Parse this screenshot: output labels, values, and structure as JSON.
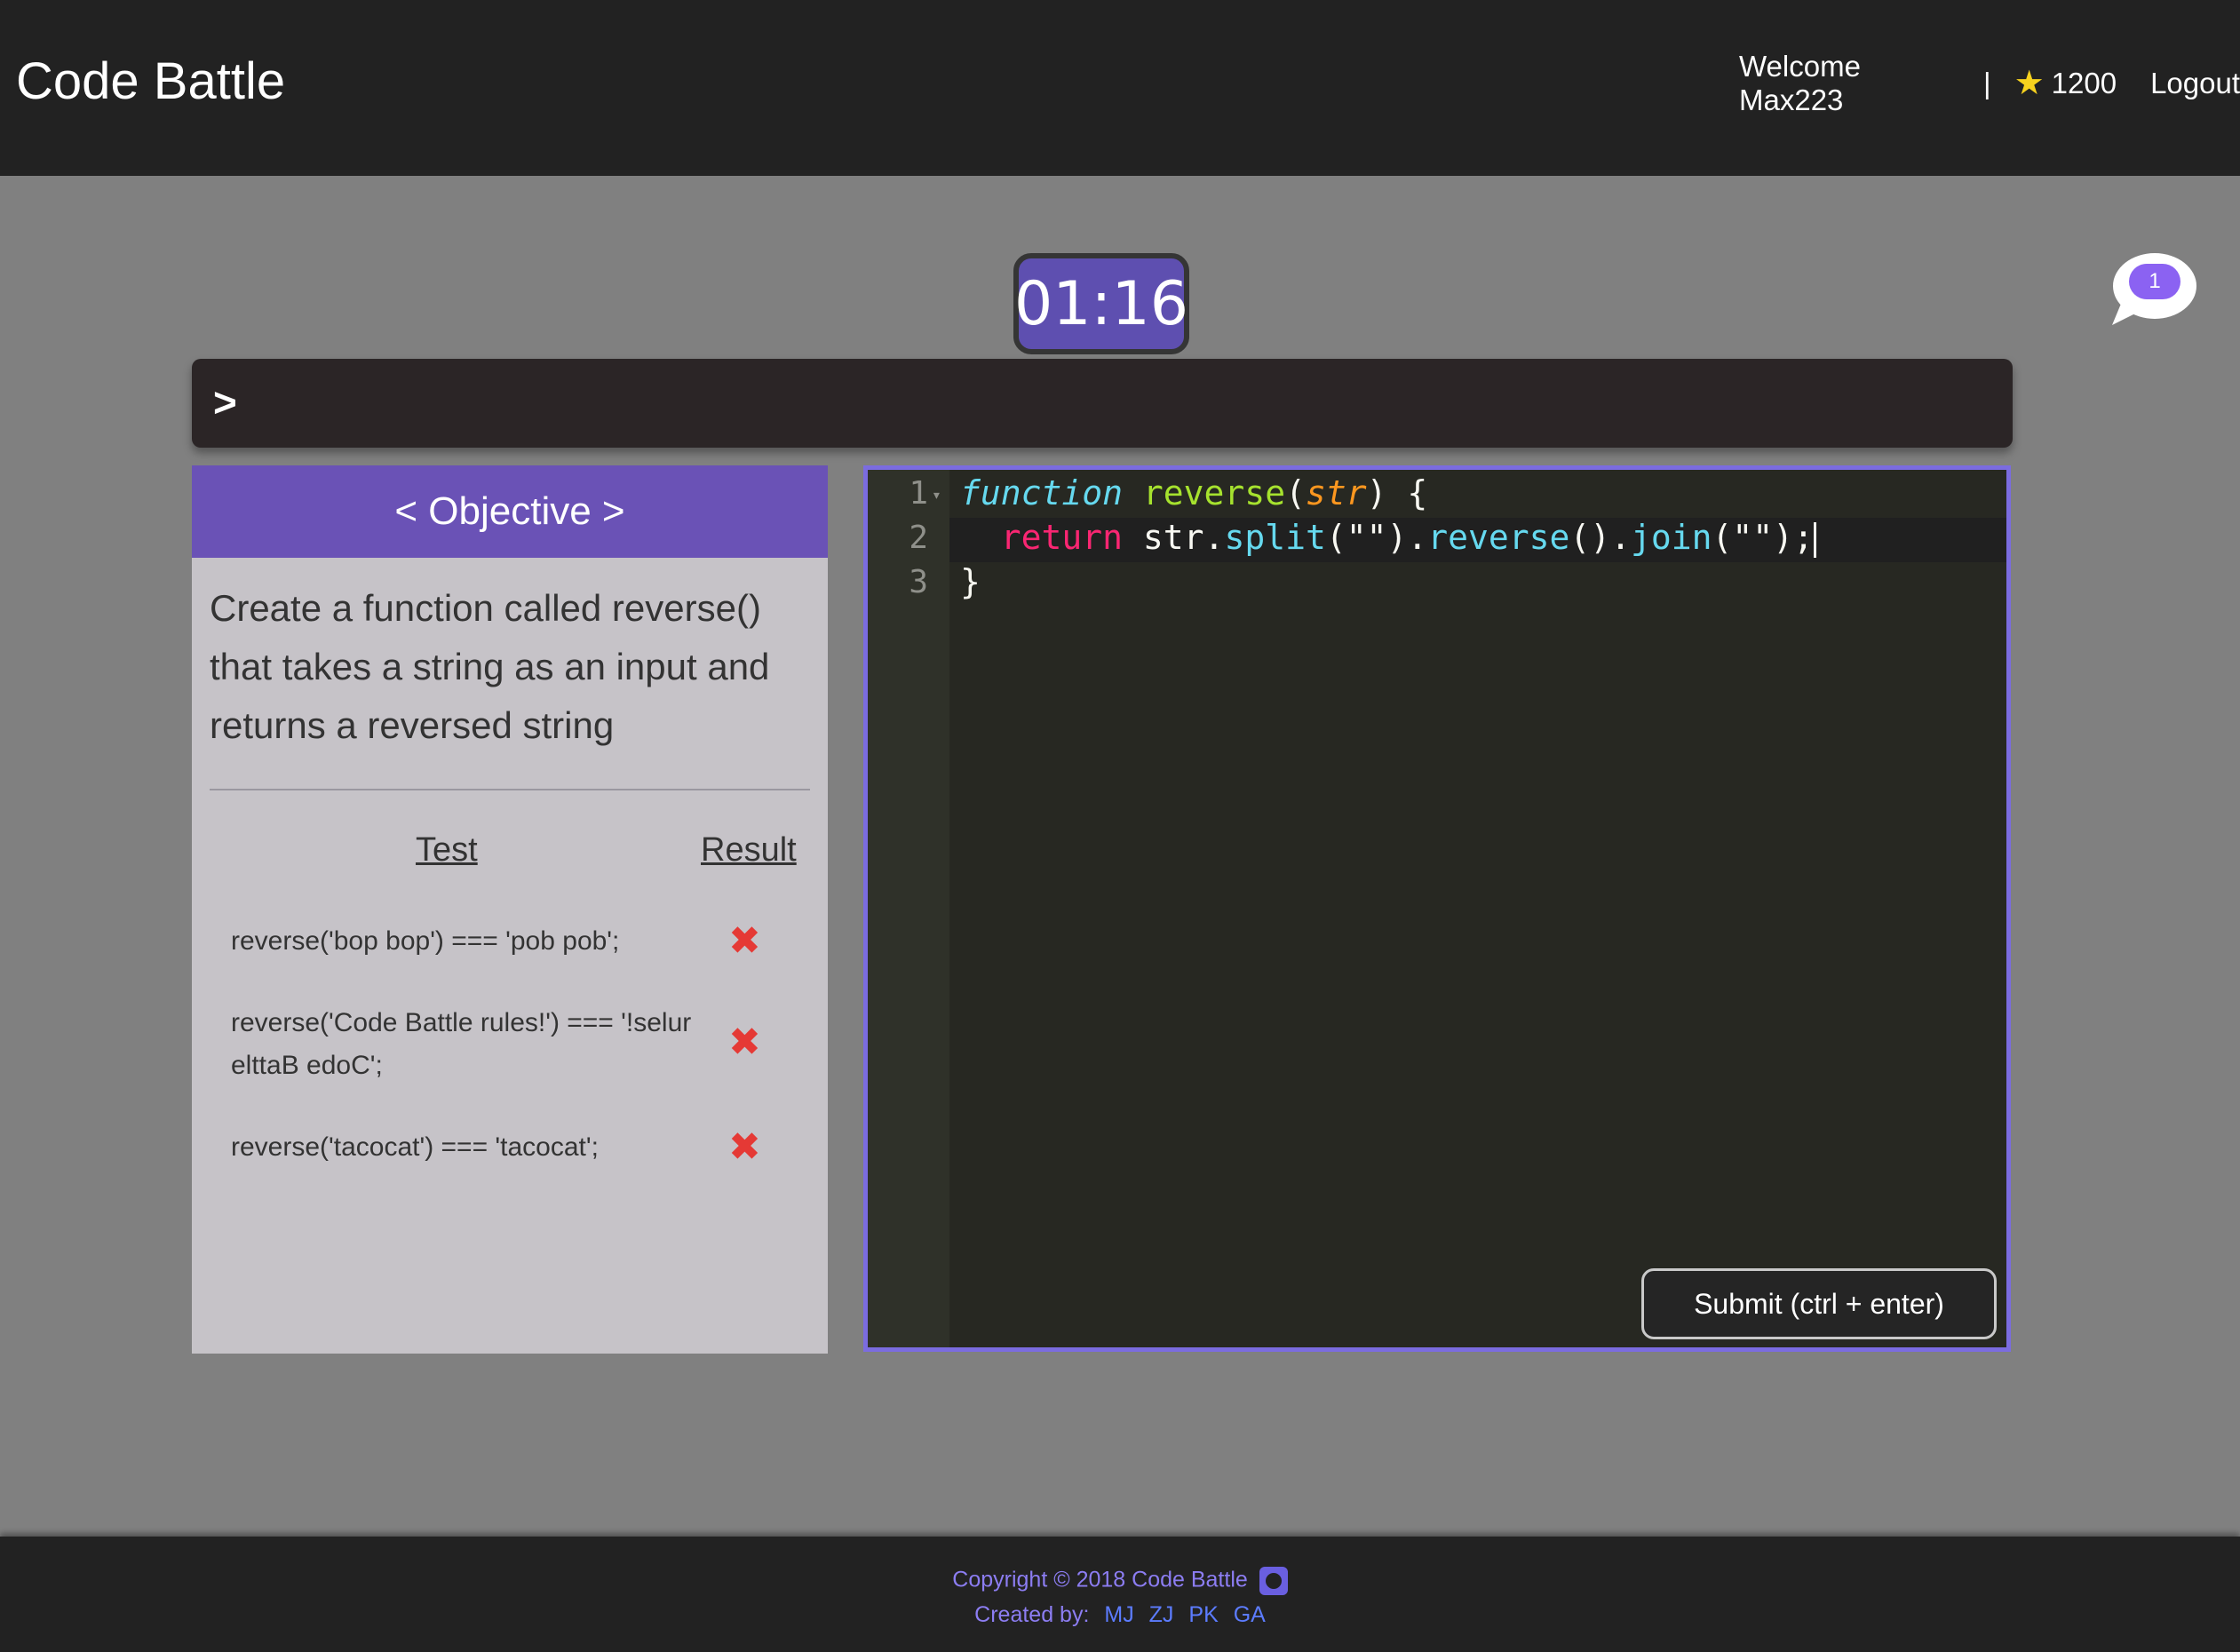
{
  "navbar": {
    "brand": "Code Battle",
    "welcome": "Welcome Max223",
    "separator": "|",
    "points": "1200",
    "logout": "Logout"
  },
  "chat": {
    "unread_count": "1"
  },
  "timer": {
    "value": "01:16"
  },
  "console": {
    "prompt": ">"
  },
  "objective": {
    "header": "< Objective >",
    "description": "Create a function called reverse() that takes a string as an input and returns a reversed string",
    "columns": {
      "test": "Test",
      "result": "Result"
    },
    "tests": [
      {
        "code": "reverse('bop bop') === 'pob pob';",
        "result": "✖"
      },
      {
        "code": "reverse('Code Battle rules!') === '!selur elttaB edoC';",
        "result": "✖"
      },
      {
        "code": "reverse('tacocat') === 'tacocat';",
        "result": "✖"
      }
    ]
  },
  "editor": {
    "line_numbers": [
      "1",
      "2",
      "3"
    ],
    "lines": {
      "l1": {
        "kw": "function",
        "name": "reverse",
        "open": "(",
        "param": "str",
        "close": ") {"
      },
      "l2": {
        "ret": "return",
        "obj": " str.",
        "split": "split",
        "split_args": "(\"\").",
        "rev": "reverse",
        "rev_args": "().",
        "join": "join",
        "join_args": "(\"\");"
      },
      "l3": "}"
    },
    "submit_label": "Submit (ctrl + enter)"
  },
  "footer": {
    "copyright": "Copyright © 2018 Code Battle",
    "created_by": "Created by:",
    "authors": [
      "MJ",
      "ZJ",
      "PK",
      "GA"
    ]
  },
  "colors": {
    "accent": "#6a52b6",
    "timer_bg": "#5e4fb0",
    "editor_border": "#7b6ce0",
    "fail": "#e53935"
  }
}
